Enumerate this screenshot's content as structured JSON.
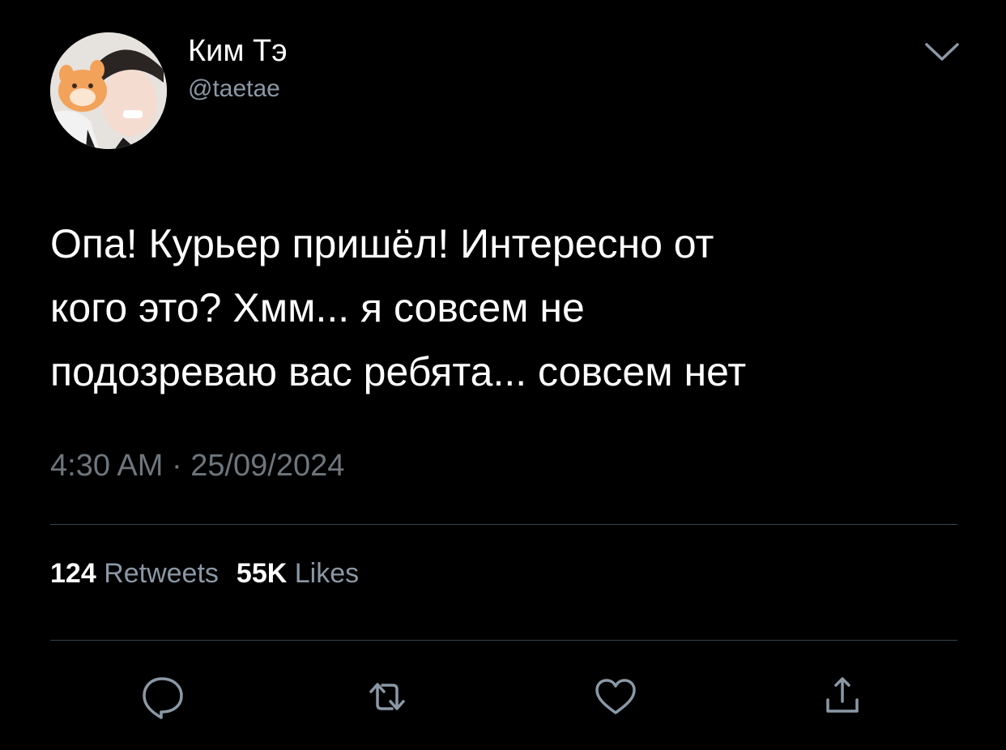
{
  "tweet": {
    "author": {
      "display_name": "Ким Тэ",
      "handle": "@taetae",
      "avatar": "profile-photo"
    },
    "text_lines": [
      "Опа! Курьер пришёл! Интересно от",
      "кого это? Хмм... я совсем не",
      "подозреваю вас ребята... совсем нет"
    ],
    "time": "4:30 AM",
    "separator": "·",
    "date": "25/09/2024",
    "stats": {
      "retweets_count": "124",
      "retweets_label": "Retweets",
      "likes_count": "55K",
      "likes_label": "Likes"
    },
    "actions": [
      "reply-icon",
      "retweet-icon",
      "like-icon",
      "share-icon"
    ],
    "menu_icon": "chevron-down-icon"
  },
  "colors": {
    "background": "#000000",
    "primary_text": "#ffffff",
    "secondary_text": "#8b98a5",
    "divider": "#38444d"
  }
}
